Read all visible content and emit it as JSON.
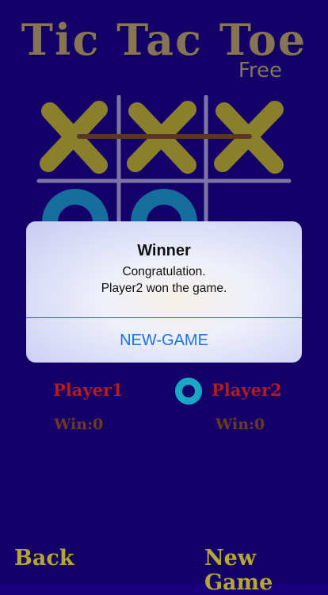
{
  "header": {
    "title": "Tic Tac Toe",
    "subtitle": "Free"
  },
  "board": {
    "cells": [
      "X",
      "X",
      "X",
      "O",
      "O",
      "",
      "",
      "",
      ""
    ],
    "winning_line": "top-row",
    "colors": {
      "x": "#c9c21e",
      "o": "#1aa6c7",
      "grid": "#b9b5d6",
      "win_line": "#7a4a22"
    }
  },
  "alert": {
    "title": "Winner",
    "message_line1": "Congratulation.",
    "message_line2": "Player2 won the game.",
    "button_label": "NEW-GAME"
  },
  "players": {
    "player1": {
      "name": "Player1",
      "wins": "Win:0"
    },
    "player2": {
      "name": "Player2",
      "wins": "Win:0"
    },
    "current_turn_marker": "O"
  },
  "footer": {
    "back_label": "Back",
    "new_game_label": "New Game"
  }
}
